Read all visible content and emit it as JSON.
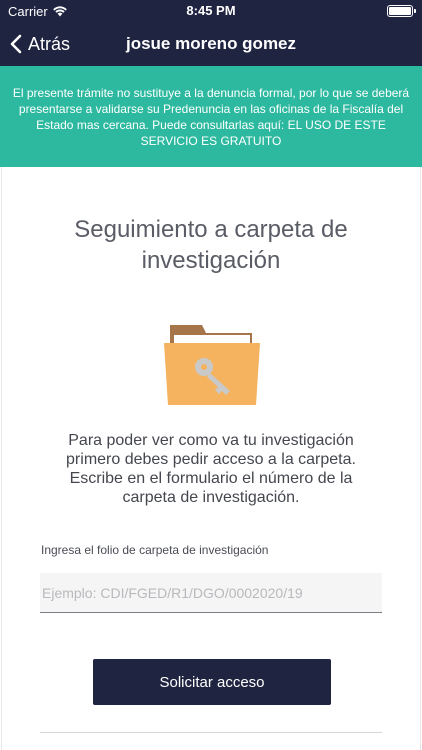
{
  "status_bar": {
    "carrier": "Carrier",
    "time": "8:45 PM"
  },
  "nav": {
    "back_label": "Atrás",
    "title": "josue moreno gomez"
  },
  "notice": {
    "text": "El presente trámite no sustituye a la denuncia formal, por lo que se deberá presentarse a validarse su Predenuncia en las oficinas de la Fiscalía del Estado mas cercana. Puede consultarlas aquí:  EL USO DE ESTE SERVICIO ES GRATUITO"
  },
  "main": {
    "title_line1": "Seguimiento a carpeta de",
    "title_line2": "investigación",
    "instructions_line1": "Para poder ver como va tu investigación",
    "instructions_line2": "primero debes pedir acceso a la carpeta.",
    "instructions_line3": "Escribe en el formulario el número de la",
    "instructions_line4": "carpeta de investigación.",
    "field_label": "Ingresa el folio de carpeta de investigación",
    "field_value": "",
    "field_placeholder": "Ejemplo: CDI/FGED/R1/DGO/0002020/19",
    "request_button_label": "Solicitar acceso"
  },
  "colors": {
    "navbar": "#1f2440",
    "banner": "#2db99f",
    "button": "#1f2440"
  },
  "icons": {
    "back": "chevron-left-icon",
    "folder": "folder-key-icon",
    "wifi": "wifi-icon",
    "battery": "battery-icon"
  }
}
